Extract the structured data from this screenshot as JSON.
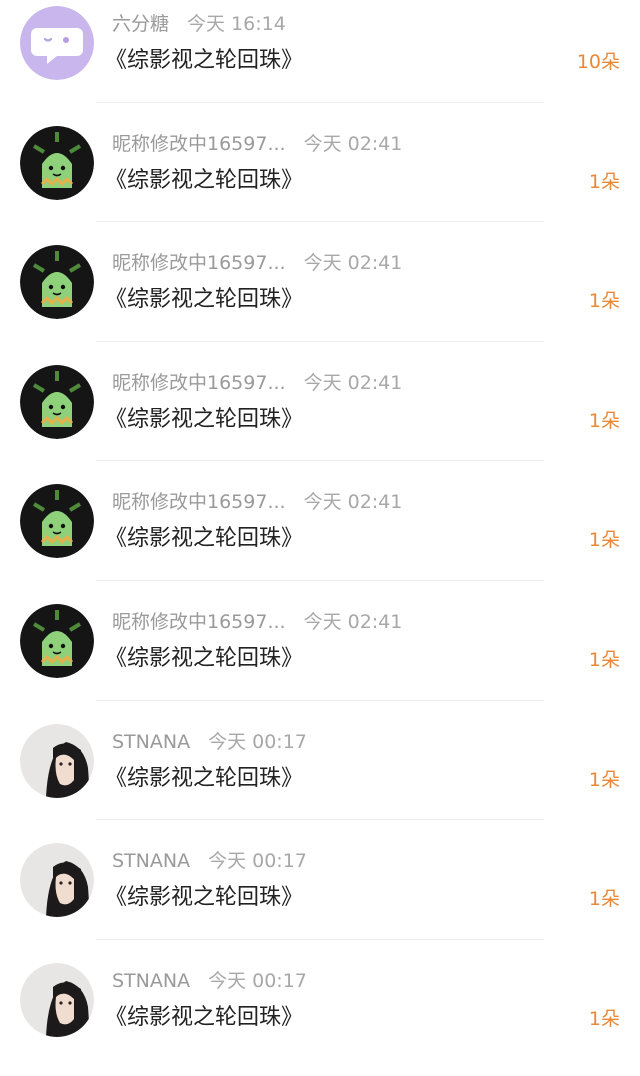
{
  "colors": {
    "amount": "#e8893a",
    "meta": "#9a9a9a",
    "book": "#222222",
    "divider": "#eeeeee"
  },
  "gifts": [
    {
      "user": "六分糖",
      "time": "今天 16:14",
      "book": "《综影视之轮回珠》",
      "amount": "10朵",
      "avatar": "purple-chat-avatar"
    },
    {
      "user": "昵称修改中16597...",
      "time": "今天 02:41",
      "book": "《综影视之轮回珠》",
      "amount": "1朵",
      "avatar": "green-creature-avatar"
    },
    {
      "user": "昵称修改中16597...",
      "time": "今天 02:41",
      "book": "《综影视之轮回珠》",
      "amount": "1朵",
      "avatar": "green-creature-avatar"
    },
    {
      "user": "昵称修改中16597...",
      "time": "今天 02:41",
      "book": "《综影视之轮回珠》",
      "amount": "1朵",
      "avatar": "green-creature-avatar"
    },
    {
      "user": "昵称修改中16597...",
      "time": "今天 02:41",
      "book": "《综影视之轮回珠》",
      "amount": "1朵",
      "avatar": "green-creature-avatar"
    },
    {
      "user": "昵称修改中16597...",
      "time": "今天 02:41",
      "book": "《综影视之轮回珠》",
      "amount": "1朵",
      "avatar": "green-creature-avatar"
    },
    {
      "user": "STNANA",
      "time": "今天 00:17",
      "book": "《综影视之轮回珠》",
      "amount": "1朵",
      "avatar": "girl-photo-avatar"
    },
    {
      "user": "STNANA",
      "time": "今天 00:17",
      "book": "《综影视之轮回珠》",
      "amount": "1朵",
      "avatar": "girl-photo-avatar"
    },
    {
      "user": "STNANA",
      "time": "今天 00:17",
      "book": "《综影视之轮回珠》",
      "amount": "1朵",
      "avatar": "girl-photo-avatar"
    }
  ]
}
